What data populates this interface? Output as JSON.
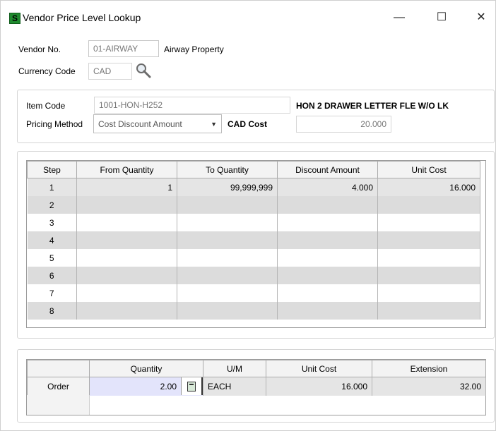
{
  "window": {
    "title": "Vendor Price Level Lookup",
    "app_icon_glyph": "S",
    "minimize_glyph": "—",
    "maximize_glyph": "☐",
    "close_glyph": "✕"
  },
  "header": {
    "vendor_no_label": "Vendor No.",
    "vendor_no_value": "01-AIRWAY",
    "vendor_name": "Airway Property",
    "currency_label": "Currency Code",
    "currency_value": "CAD",
    "lookup_icon": "magnifier-icon"
  },
  "item": {
    "item_code_label": "Item Code",
    "item_code_value": "1001-HON-H252",
    "item_description": "HON 2 DRAWER LETTER FLE W/O LK",
    "pricing_method_label": "Pricing Method",
    "pricing_method_value": "Cost Discount Amount",
    "cost_label": "CAD Cost",
    "cost_value": "20.000"
  },
  "steps_table": {
    "columns": [
      "Step",
      "From Quantity",
      "To Quantity",
      "Discount Amount",
      "Unit Cost"
    ],
    "rows": [
      [
        "1",
        "1",
        "99,999,999",
        "4.000",
        "16.000"
      ],
      [
        "2",
        "",
        "",
        "",
        ""
      ],
      [
        "3",
        "",
        "",
        "",
        ""
      ],
      [
        "4",
        "",
        "",
        "",
        ""
      ],
      [
        "5",
        "",
        "",
        "",
        ""
      ],
      [
        "6",
        "",
        "",
        "",
        ""
      ],
      [
        "7",
        "",
        "",
        "",
        ""
      ],
      [
        "8",
        "",
        "",
        "",
        ""
      ]
    ]
  },
  "order_table": {
    "columns": [
      "",
      "Quantity",
      "U/M",
      "Unit Cost",
      "Extension"
    ],
    "row": {
      "label": "Order",
      "quantity": "2.00",
      "um": "EACH",
      "unit_cost": "16.000",
      "extension": "32.00"
    }
  },
  "colors": {
    "accent_green": "#1f8a2e",
    "quantity_highlight": "#e3e4fb"
  }
}
